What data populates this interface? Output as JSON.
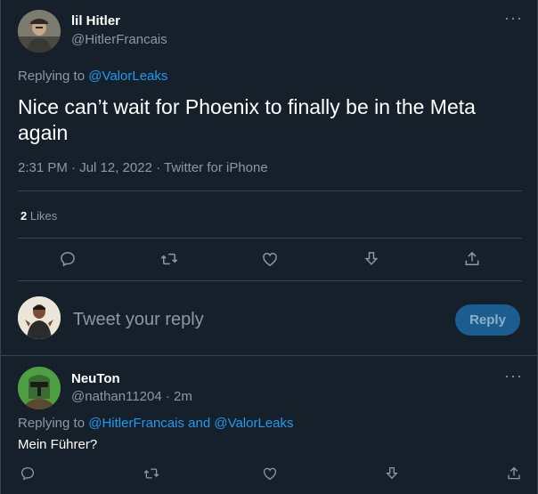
{
  "tweet": {
    "author_name": "lil Hitler",
    "author_handle": "@HitlerFrancais",
    "replying_prefix": "Replying to",
    "replying_to": "@ValorLeaks",
    "text": "Nice can’t wait for Phoenix to finally be in the Meta again",
    "timestamp": "2:31 PM · Jul 12, 2022 · Twitter for iPhone",
    "likes_count": "2",
    "likes_label": "Likes",
    "more_label": "···"
  },
  "composer": {
    "placeholder": "Tweet your reply",
    "reply_button": "Reply"
  },
  "reply": {
    "author_name": "NeuTon",
    "author_handle": "@nathan11204 · 2m",
    "replying_prefix": "Replying to",
    "replying_to_1": "@HitlerFrancais",
    "replying_and": "and",
    "replying_to_2": "@ValorLeaks",
    "text": "Mein Führer?",
    "more_label": "···"
  },
  "colors": {
    "background": "#15202b",
    "accent": "#1d9bf0",
    "muted": "#8b98a5",
    "border": "#38444d"
  },
  "icons": [
    "comment-icon",
    "retweet-icon",
    "like-icon",
    "download-icon",
    "share-icon"
  ]
}
